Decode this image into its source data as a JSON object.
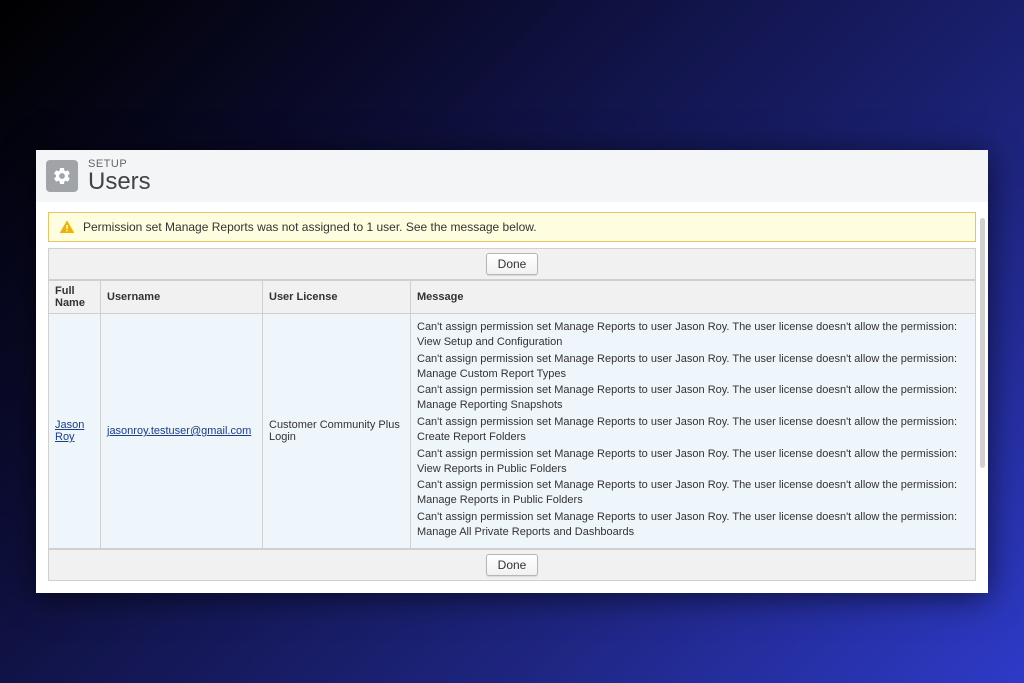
{
  "header": {
    "setup": "SETUP",
    "title": "Users"
  },
  "alert": {
    "message": "Permission set Manage Reports was not assigned to 1 user. See the message below."
  },
  "buttons": {
    "done": "Done"
  },
  "table": {
    "headers": {
      "fullname": "Full Name",
      "username": "Username",
      "license": "User License",
      "message": "Message"
    },
    "rows": [
      {
        "fullname": "Jason Roy",
        "username": "jasonroy.testuser@gmail.com",
        "license": "Customer Community Plus Login",
        "messages": [
          "Can't assign permission set Manage Reports to user Jason Roy. The user license doesn't allow the permission: View Setup and Configuration",
          "Can't assign permission set Manage Reports to user Jason Roy. The user license doesn't allow the permission: Manage Custom Report Types",
          "Can't assign permission set Manage Reports to user Jason Roy. The user license doesn't allow the permission: Manage Reporting Snapshots",
          "Can't assign permission set Manage Reports to user Jason Roy. The user license doesn't allow the permission: Create Report Folders",
          "Can't assign permission set Manage Reports to user Jason Roy. The user license doesn't allow the permission: View Reports in Public Folders",
          "Can't assign permission set Manage Reports to user Jason Roy. The user license doesn't allow the permission: Manage Reports in Public Folders",
          "Can't assign permission set Manage Reports to user Jason Roy. The user license doesn't allow the permission: Manage All Private Reports and Dashboards"
        ]
      }
    ]
  }
}
